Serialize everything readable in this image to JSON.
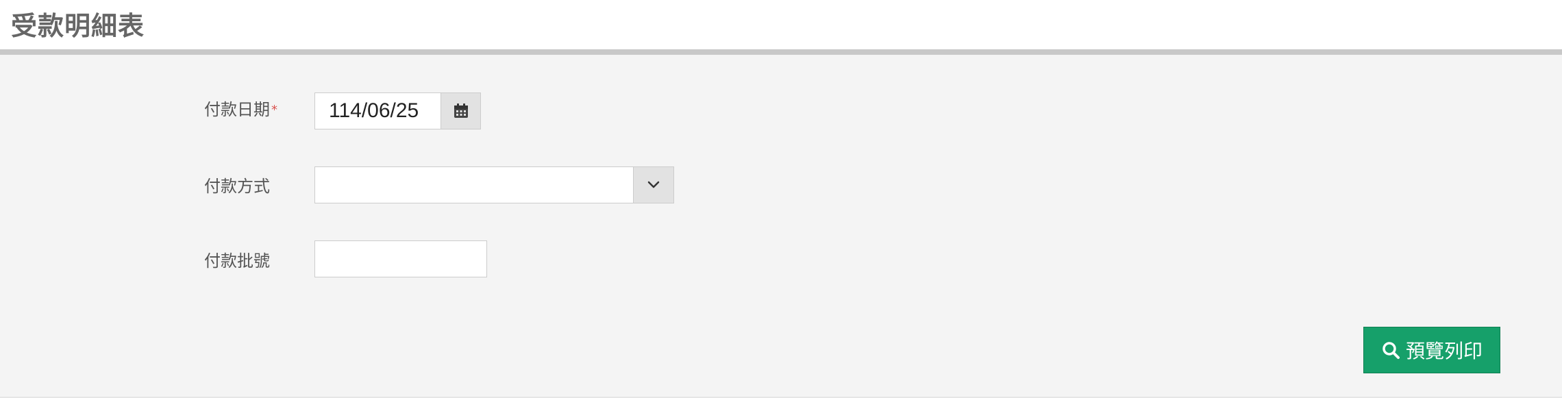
{
  "page": {
    "title": "受款明細表"
  },
  "form": {
    "payment_date": {
      "label": "付款日期",
      "required_mark": "*",
      "value": "114/06/25",
      "icon": "calendar-icon"
    },
    "payment_method": {
      "label": "付款方式",
      "value": "",
      "icon": "chevron-down-icon"
    },
    "payment_batch": {
      "label": "付款批號",
      "value": ""
    }
  },
  "actions": {
    "preview_print_label": "預覽列印",
    "preview_print_icon": "search-icon"
  },
  "colors": {
    "accent": "#16a06a",
    "required": "#d9534f",
    "panel_background": "#f4f4f4"
  }
}
